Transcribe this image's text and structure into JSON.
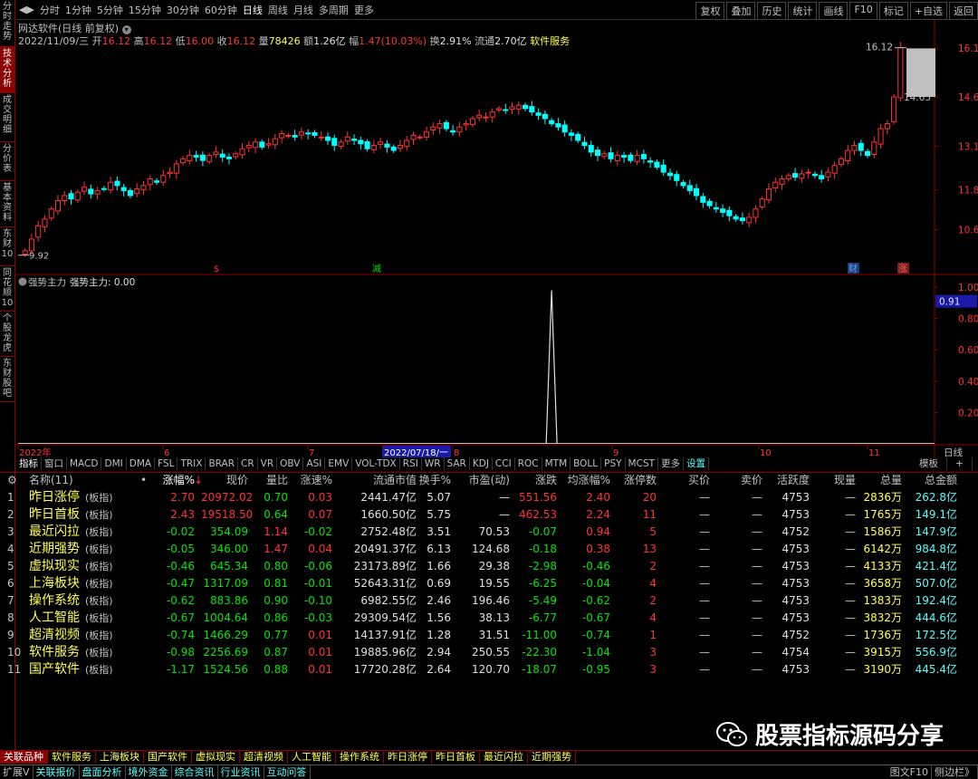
{
  "left_tabs": [
    {
      "label": "分时走势",
      "active": false
    },
    {
      "label": "技术分析",
      "active": true
    },
    {
      "label": "成交明细",
      "active": false
    },
    {
      "label": "分价表",
      "active": false
    },
    {
      "label": "基本资料",
      "active": false
    },
    {
      "label": "东财10",
      "active": false
    },
    {
      "label": "同花顺10",
      "active": false
    },
    {
      "label": "个股龙虎",
      "active": false
    },
    {
      "label": "东财股吧",
      "active": false
    }
  ],
  "toolbar": {
    "periods": [
      "分时",
      "1分钟",
      "5分钟",
      "15分钟",
      "30分钟",
      "60分钟",
      "日线",
      "周线",
      "月线",
      "多周期",
      "更多"
    ],
    "active_period": "日线",
    "right": [
      "复权",
      "叠加",
      "历史",
      "统计",
      "画线",
      "F10",
      "标记",
      "+自选",
      "返回"
    ]
  },
  "header": {
    "stock_name": "网达软件(日线 前复权)",
    "date": "2022/11/09/三",
    "open_label": "开",
    "open": "16.12",
    "high_label": "高",
    "high": "16.12",
    "low_label": "低",
    "low": "16.00",
    "close_label": "收",
    "close": "16.12",
    "volume_label": "量",
    "volume": "78426",
    "amount_label": "额",
    "amount": "1.26亿",
    "change_label": "幅",
    "change": "1.47(10.03%)",
    "turnover_label": "换",
    "turnover": "2.91%",
    "float_label": "流通",
    "float": "2.70亿",
    "industry": "软件服务"
  },
  "price_axis": {
    "labels": [
      "16.11",
      "14.65",
      "13.18",
      "11.87",
      "10.68"
    ],
    "low_mark": "9.92",
    "high_mark": "16.12",
    "last_mark": "14.65"
  },
  "event_markers": [
    "$",
    "减",
    "财",
    "涨"
  ],
  "indicator": {
    "name": "强势主力",
    "value_label": "强势主力: 0.00",
    "axis_labels": [
      "1.00",
      "0.80",
      "0.60",
      "0.40",
      "0.20"
    ],
    "current": "0.91"
  },
  "date_axis": {
    "labels": [
      "2022年",
      "6",
      "7",
      "2022/07/18/一",
      "8",
      "9",
      "10",
      "11"
    ],
    "period": "日线"
  },
  "indicator_tabs": [
    "指标",
    "窗口",
    "MACD",
    "DMI",
    "DMA",
    "FSL",
    "TRIX",
    "BRAR",
    "CR",
    "VR",
    "OBV",
    "ASI",
    "EMV",
    "VOL-TDX",
    "RSI",
    "WR",
    "SAR",
    "KDJ",
    "CCI",
    "ROC",
    "MTM",
    "BOLL",
    "PSY",
    "MCST",
    "更多",
    "设置"
  ],
  "indicator_tabs_right": [
    "模板",
    "+",
    "-"
  ],
  "table": {
    "headers": [
      "名称(11)",
      "涨幅%",
      "现价",
      "量比",
      "涨速%",
      "流通市值",
      "换手%",
      "市盈(动)",
      "涨跌",
      "均涨幅%",
      "涨停数",
      "买价",
      "卖价",
      "活跃度",
      "现量",
      "总量",
      "总金额"
    ],
    "rows": [
      {
        "no": "1",
        "name": "昨日涨停",
        "tag": "(板指)",
        "chg": "2.70",
        "price": "20972.02",
        "vr": "0.70",
        "spd": "0.03",
        "mcap": "2441.47亿",
        "turn": "5.07",
        "pe": "—",
        "delta": "551.56",
        "avg": "2.40",
        "lim": "20",
        "bid": "—",
        "ask": "—",
        "act": "4753",
        "cur": "—",
        "vol": "2836万",
        "amt": "262.8亿"
      },
      {
        "no": "2",
        "name": "昨日首板",
        "tag": "(板指)",
        "chg": "2.43",
        "price": "19518.50",
        "vr": "0.64",
        "spd": "0.07",
        "mcap": "1660.50亿",
        "turn": "5.75",
        "pe": "—",
        "delta": "462.53",
        "avg": "2.24",
        "lim": "11",
        "bid": "—",
        "ask": "—",
        "act": "4753",
        "cur": "—",
        "vol": "1765万",
        "amt": "149.1亿"
      },
      {
        "no": "3",
        "name": "最近闪拉",
        "tag": "(板指)",
        "chg": "-0.02",
        "price": "354.09",
        "vr": "1.14",
        "spd": "-0.02",
        "mcap": "2752.48亿",
        "turn": "3.51",
        "pe": "70.53",
        "delta": "-0.07",
        "avg": "0.94",
        "lim": "5",
        "bid": "—",
        "ask": "—",
        "act": "4752",
        "cur": "—",
        "vol": "1586万",
        "amt": "147.9亿"
      },
      {
        "no": "4",
        "name": "近期强势",
        "tag": "(板指)",
        "chg": "-0.05",
        "price": "346.00",
        "vr": "1.47",
        "spd": "0.04",
        "mcap": "20491.37亿",
        "turn": "6.13",
        "pe": "124.68",
        "delta": "-0.18",
        "avg": "0.38",
        "lim": "13",
        "bid": "—",
        "ask": "—",
        "act": "4753",
        "cur": "—",
        "vol": "6142万",
        "amt": "984.8亿"
      },
      {
        "no": "5",
        "name": "虚拟现实",
        "tag": "(板指)",
        "chg": "-0.46",
        "price": "645.34",
        "vr": "0.80",
        "spd": "-0.06",
        "mcap": "23173.89亿",
        "turn": "1.66",
        "pe": "29.38",
        "delta": "-2.98",
        "avg": "-0.46",
        "lim": "2",
        "bid": "—",
        "ask": "—",
        "act": "4753",
        "cur": "—",
        "vol": "4133万",
        "amt": "421.4亿"
      },
      {
        "no": "6",
        "name": "上海板块",
        "tag": "(板指)",
        "chg": "-0.47",
        "price": "1317.09",
        "vr": "0.81",
        "spd": "-0.01",
        "mcap": "52643.31亿",
        "turn": "0.69",
        "pe": "19.55",
        "delta": "-6.25",
        "avg": "-0.04",
        "lim": "4",
        "bid": "—",
        "ask": "—",
        "act": "4753",
        "cur": "—",
        "vol": "3658万",
        "amt": "507.0亿"
      },
      {
        "no": "7",
        "name": "操作系统",
        "tag": "(板指)",
        "chg": "-0.62",
        "price": "883.86",
        "vr": "0.90",
        "spd": "-0.10",
        "mcap": "6982.55亿",
        "turn": "2.46",
        "pe": "196.46",
        "delta": "-5.49",
        "avg": "-0.62",
        "lim": "2",
        "bid": "—",
        "ask": "—",
        "act": "4753",
        "cur": "—",
        "vol": "1383万",
        "amt": "192.4亿"
      },
      {
        "no": "8",
        "name": "人工智能",
        "tag": "(板指)",
        "chg": "-0.67",
        "price": "1004.64",
        "vr": "0.86",
        "spd": "-0.03",
        "mcap": "29309.54亿",
        "turn": "1.56",
        "pe": "38.13",
        "delta": "-6.77",
        "avg": "-0.67",
        "lim": "4",
        "bid": "—",
        "ask": "—",
        "act": "4753",
        "cur": "—",
        "vol": "3832万",
        "amt": "444.6亿"
      },
      {
        "no": "9",
        "name": "超清视频",
        "tag": "(板指)",
        "chg": "-0.74",
        "price": "1466.29",
        "vr": "0.77",
        "spd": "0.01",
        "mcap": "14137.91亿",
        "turn": "1.28",
        "pe": "31.51",
        "delta": "-11.00",
        "avg": "-0.74",
        "lim": "1",
        "bid": "—",
        "ask": "—",
        "act": "4752",
        "cur": "—",
        "vol": "1736万",
        "amt": "172.5亿"
      },
      {
        "no": "10",
        "name": "软件服务",
        "tag": "(板指)",
        "chg": "-0.98",
        "price": "2256.69",
        "vr": "0.87",
        "spd": "0.01",
        "mcap": "19885.96亿",
        "turn": "2.94",
        "pe": "250.55",
        "delta": "-22.30",
        "avg": "-1.04",
        "lim": "3",
        "bid": "—",
        "ask": "—",
        "act": "4754",
        "cur": "—",
        "vol": "3915万",
        "amt": "556.9亿"
      },
      {
        "no": "11",
        "name": "国产软件",
        "tag": "(板指)",
        "chg": "-1.17",
        "price": "1524.56",
        "vr": "0.88",
        "spd": "0.01",
        "mcap": "17720.28亿",
        "turn": "2.64",
        "pe": "120.70",
        "delta": "-18.07",
        "avg": "-0.95",
        "lim": "3",
        "bid": "—",
        "ask": "—",
        "act": "4753",
        "cur": "—",
        "vol": "3190万",
        "amt": "445.4亿"
      }
    ]
  },
  "bottom_tabs": [
    "关联品种",
    "软件服务",
    "上海板块",
    "国产软件",
    "虚拟现实",
    "超清视频",
    "人工智能",
    "操作系统",
    "昨日涨停",
    "昨日首板",
    "最近闪拉",
    "近期强势"
  ],
  "status_bar": [
    "扩展V",
    "关联报价",
    "盘面分析",
    "境外资金",
    "综合资讯",
    "行业资讯",
    "互动问答"
  ],
  "status_right": [
    "图文F10",
    "侧边栏》"
  ],
  "watermark": "股票指标源码分享",
  "colors": {
    "up": "#ff3232",
    "down": "#00ffff",
    "frame": "#8b0000",
    "yellow": "#ffff54",
    "cyan": "#54ffff"
  },
  "chart_data": {
    "type": "candlestick",
    "title": "网达软件(日线 前复权)",
    "ylim": [
      9.92,
      16.12
    ],
    "y_ticks": [
      10.68,
      11.87,
      13.18,
      14.65,
      16.11
    ],
    "x_month_labels": [
      "2022年",
      "6",
      "7",
      "8",
      "9",
      "10",
      "11"
    ],
    "closes": [
      10.05,
      10.4,
      10.8,
      11.0,
      11.3,
      11.55,
      11.7,
      11.6,
      11.8,
      11.95,
      11.75,
      11.85,
      11.9,
      12.1,
      12.0,
      11.85,
      11.7,
      11.9,
      12.0,
      12.2,
      12.1,
      12.3,
      12.4,
      12.65,
      12.8,
      12.9,
      12.85,
      12.75,
      12.9,
      13.0,
      12.85,
      12.8,
      12.95,
      13.1,
      13.2,
      13.3,
      13.15,
      13.25,
      13.4,
      13.55,
      13.5,
      13.45,
      13.6,
      13.55,
      13.5,
      13.45,
      13.35,
      13.2,
      13.3,
      13.45,
      13.35,
      13.25,
      13.1,
      13.2,
      13.3,
      13.15,
      13.05,
      13.2,
      13.35,
      13.5,
      13.45,
      13.6,
      13.75,
      13.85,
      13.7,
      13.6,
      13.75,
      13.85,
      14.0,
      14.1,
      14.05,
      14.2,
      14.3,
      14.25,
      14.35,
      14.4,
      14.3,
      14.2,
      14.1,
      14.0,
      13.85,
      13.75,
      13.6,
      13.5,
      13.35,
      13.2,
      13.0,
      12.9,
      12.95,
      12.8,
      12.9,
      12.85,
      12.75,
      12.9,
      12.8,
      12.7,
      12.55,
      12.4,
      12.3,
      12.15,
      12.0,
      11.85,
      11.7,
      11.5,
      11.4,
      11.3,
      11.2,
      11.1,
      11.0,
      10.95,
      11.05,
      11.3,
      11.6,
      11.9,
      12.1,
      12.2,
      12.3,
      12.25,
      12.35,
      12.4,
      12.3,
      12.2,
      12.4,
      12.6,
      12.8,
      13.05,
      13.2,
      13.05,
      12.9,
      13.3,
      13.7,
      13.85,
      14.65,
      16.12
    ],
    "indicator": {
      "name": "强势主力",
      "spike_index": 80,
      "spike_value": 0.98,
      "last_value": 0.91
    }
  }
}
